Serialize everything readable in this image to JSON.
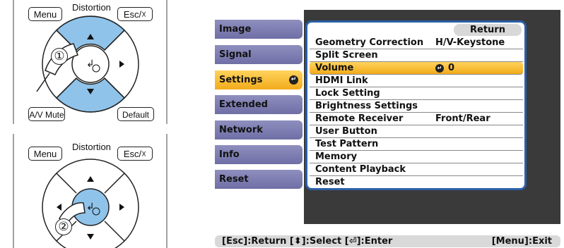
{
  "remote_top": {
    "menu_label": "Menu",
    "distortion_label": "Distortion",
    "esc_label": "Esc/☓",
    "av_mute_label": "A/V Mute",
    "default_label": "Default",
    "step_label": "①"
  },
  "remote_bottom": {
    "menu_label": "Menu",
    "distortion_label": "Distortion",
    "esc_label": "Esc/☓",
    "step_label": "②"
  },
  "menu": {
    "categories": [
      {
        "label": "Image"
      },
      {
        "label": "Signal"
      },
      {
        "label": "Settings",
        "selected": true
      },
      {
        "label": "Extended"
      },
      {
        "label": "Network"
      },
      {
        "label": "Info"
      },
      {
        "label": "Reset"
      }
    ],
    "return_label": "Return",
    "items": [
      {
        "label": "Geometry Correction",
        "value": "H/V-Keystone"
      },
      {
        "label": "Split Screen",
        "value": ""
      },
      {
        "label": "Volume",
        "value": "0",
        "selected": true
      },
      {
        "label": "HDMI Link",
        "value": ""
      },
      {
        "label": "Lock Setting",
        "value": ""
      },
      {
        "label": "Brightness Settings",
        "value": ""
      },
      {
        "label": "Remote Receiver",
        "value": "Front/Rear"
      },
      {
        "label": "User Button",
        "value": ""
      },
      {
        "label": "Test Pattern",
        "value": ""
      },
      {
        "label": "Memory",
        "value": ""
      },
      {
        "label": "Content Playback",
        "value": ""
      },
      {
        "label": "Reset",
        "value": ""
      }
    ]
  },
  "help_bar": {
    "left": "[Esc]:Return [⬍]:Select [⏎]:Enter",
    "right": "[Menu]:Exit"
  },
  "colors": {
    "selected_highlight": "#f2ab1b",
    "category_bg": "#7b7bb0",
    "panel_border": "#2b5fa6",
    "remote_dpad_blue": "#8fc3ea"
  }
}
